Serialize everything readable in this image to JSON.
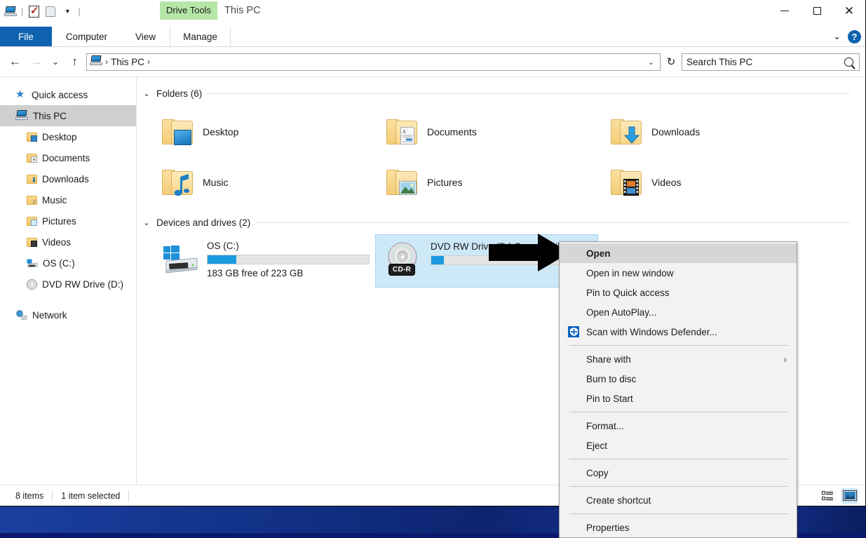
{
  "window": {
    "title": "This PC",
    "contextual_tab": "Drive Tools",
    "controls": {
      "minimize": "—",
      "maximize": "□",
      "close": "✕"
    },
    "ribbon_collapse": "⌄",
    "help": "?"
  },
  "quick_access_toolbar": {
    "items": [
      {
        "name": "this-pc-icon",
        "label": "This PC"
      },
      {
        "name": "properties-icon",
        "label": "Properties"
      },
      {
        "name": "new-folder-icon",
        "label": "New folder"
      },
      {
        "name": "customize-dropdown",
        "label": "⏷"
      }
    ]
  },
  "ribbon": {
    "tabs": [
      {
        "label": "File",
        "state": "file"
      },
      {
        "label": "Computer",
        "state": "normal"
      },
      {
        "label": "View",
        "state": "normal"
      },
      {
        "label": "Manage",
        "state": "contextual"
      }
    ]
  },
  "navigation": {
    "back": "←",
    "forward": "→",
    "recent": "⌄",
    "up": "↑",
    "refresh": "↻",
    "breadcrumb": {
      "root_icon": "this-pc-icon",
      "sep1": "›",
      "path": "This PC",
      "sep2": "›"
    },
    "address_chevron": "⌄"
  },
  "search": {
    "placeholder": "Search This PC",
    "value": "Search This PC"
  },
  "sidebar": {
    "items": [
      {
        "label": "Quick access",
        "icon": "quick-access-star-icon",
        "level": 0,
        "selected": false
      },
      {
        "label": "This PC",
        "icon": "this-pc-icon",
        "level": 0,
        "selected": true
      },
      {
        "label": "Desktop",
        "icon": "desktop-folder-icon",
        "level": 1,
        "selected": false
      },
      {
        "label": "Documents",
        "icon": "documents-folder-icon",
        "level": 1,
        "selected": false
      },
      {
        "label": "Downloads",
        "icon": "downloads-folder-icon",
        "level": 1,
        "selected": false
      },
      {
        "label": "Music",
        "icon": "music-folder-icon",
        "level": 1,
        "selected": false
      },
      {
        "label": "Pictures",
        "icon": "pictures-folder-icon",
        "level": 1,
        "selected": false
      },
      {
        "label": "Videos",
        "icon": "videos-folder-icon",
        "level": 1,
        "selected": false
      },
      {
        "label": "OS (C:)",
        "icon": "hard-drive-icon",
        "level": 1,
        "selected": false
      },
      {
        "label": "DVD RW Drive (D:)",
        "icon": "optical-disc-icon",
        "level": 1,
        "selected": false
      },
      {
        "label": "Network",
        "icon": "network-icon",
        "level": 0,
        "selected": false
      }
    ]
  },
  "content": {
    "groups": [
      {
        "title": "Folders (6)",
        "chevron": "⌄"
      },
      {
        "title": "Devices and drives (2)",
        "chevron": "⌄"
      }
    ],
    "folders": [
      {
        "name": "Desktop",
        "icon": "desktop-folder-icon"
      },
      {
        "name": "Documents",
        "icon": "documents-folder-icon"
      },
      {
        "name": "Downloads",
        "icon": "downloads-folder-icon"
      },
      {
        "name": "Music",
        "icon": "music-folder-icon"
      },
      {
        "name": "Pictures",
        "icon": "pictures-folder-icon"
      },
      {
        "name": "Videos",
        "icon": "videos-folder-icon"
      }
    ],
    "drives": [
      {
        "name": "OS (C:)",
        "icon": "windows-hard-drive-icon",
        "free_text": "183 GB free of 223 GB",
        "used_percent": 18,
        "bar_color": "#1b9ae0",
        "selected": false,
        "badge": ""
      },
      {
        "name": "DVD RW Drive (D:) Summit Silica CD",
        "icon": "cd-rom-icon",
        "free_text": "",
        "used_percent": 8,
        "bar_color": "#1b9ae0",
        "selected": true,
        "badge": "CD-R"
      }
    ]
  },
  "context_menu": {
    "items": [
      {
        "label": "Open",
        "highlighted": true,
        "icon": "",
        "submenu": false,
        "separator_after": false
      },
      {
        "label": "Open in new window",
        "highlighted": false,
        "icon": "",
        "submenu": false,
        "separator_after": false
      },
      {
        "label": "Pin to Quick access",
        "highlighted": false,
        "icon": "",
        "submenu": false,
        "separator_after": false
      },
      {
        "label": "Open AutoPlay...",
        "highlighted": false,
        "icon": "",
        "submenu": false,
        "separator_after": false
      },
      {
        "label": "Scan with Windows Defender...",
        "highlighted": false,
        "icon": "defender-shield-icon",
        "submenu": false,
        "separator_after": true
      },
      {
        "label": "Share with",
        "highlighted": false,
        "icon": "",
        "submenu": true,
        "separator_after": false
      },
      {
        "label": "Burn to disc",
        "highlighted": false,
        "icon": "",
        "submenu": false,
        "separator_after": false
      },
      {
        "label": "Pin to Start",
        "highlighted": false,
        "icon": "",
        "submenu": false,
        "separator_after": true
      },
      {
        "label": "Format...",
        "highlighted": false,
        "icon": "",
        "submenu": false,
        "separator_after": false
      },
      {
        "label": "Eject",
        "highlighted": false,
        "icon": "",
        "submenu": false,
        "separator_after": true
      },
      {
        "label": "Copy",
        "highlighted": false,
        "icon": "",
        "submenu": false,
        "separator_after": true
      },
      {
        "label": "Create shortcut",
        "highlighted": false,
        "icon": "",
        "submenu": false,
        "separator_after": true
      },
      {
        "label": "Properties",
        "highlighted": false,
        "icon": "",
        "submenu": false,
        "separator_after": false
      }
    ],
    "submenu_marker": "›"
  },
  "status_bar": {
    "item_count": "8 items",
    "selection": "1 item selected",
    "views": [
      {
        "name": "details-view-button",
        "active": false
      },
      {
        "name": "large-icons-view-button",
        "active": true
      }
    ]
  }
}
